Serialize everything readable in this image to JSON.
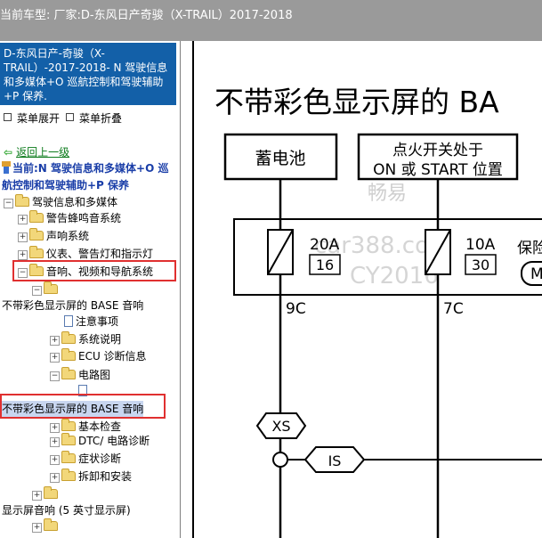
{
  "titlebar": {
    "text": "当前车型:   厂家:D-东风日产奇骏（X-TRAIL）2017-2018"
  },
  "sidebar": {
    "header": "D-东风日产-奇骏（X-TRAIL）-2017-2018- N 驾驶信息和多媒体+O 巡航控制和驾驶辅助+P 保养.",
    "expand_label": "菜单展开",
    "collapse_label": "菜单折叠",
    "back_label": "返回上一级",
    "current_label": "当前:N 驾驶信息和多媒体+O 巡航控制和驾驶辅助+P 保养",
    "tree": {
      "root": "驾驶信息和多媒体",
      "warn_buzzer": "警告蜂鸣音系统",
      "sound": "声响系统",
      "meter": "仪表、警告灯和指示灯",
      "audio_nav": "音响、视频和导航系统",
      "base_audio_1": "不带彩色显示屏的 BASE 音响",
      "notes": "注意事项",
      "desc": "系统说明",
      "ecu_diag": "ECU 诊断信息",
      "circuit": "电路图",
      "base_audio_2": "不带彩色显示屏的 BASE 音响",
      "basic_check": "基本检查",
      "dtc": "DTC/ 电路诊断",
      "symptom": "症状诊断",
      "remove": "拆卸和安装",
      "display_5in": "显示屏音响 (5 英寸显示屏)"
    }
  },
  "diagram": {
    "title": "不带彩色显示屏的 BA",
    "battery": "蓄电池",
    "ignition_line1": "点火开关处于",
    "ignition_line2": "ON 或 START 位置",
    "fuse1_amp": "20A",
    "fuse1_no": "16",
    "fuse2_amp": "10A",
    "fuse2_no": "30",
    "fuse_box_label": "保险",
    "fuse_box_m": "M",
    "conn1": "9C",
    "conn2": "7C",
    "xs": "XS",
    "is": "IS",
    "watermark1": "畅易",
    "watermark2": "car388.com",
    "watermark3": "CY2016"
  }
}
